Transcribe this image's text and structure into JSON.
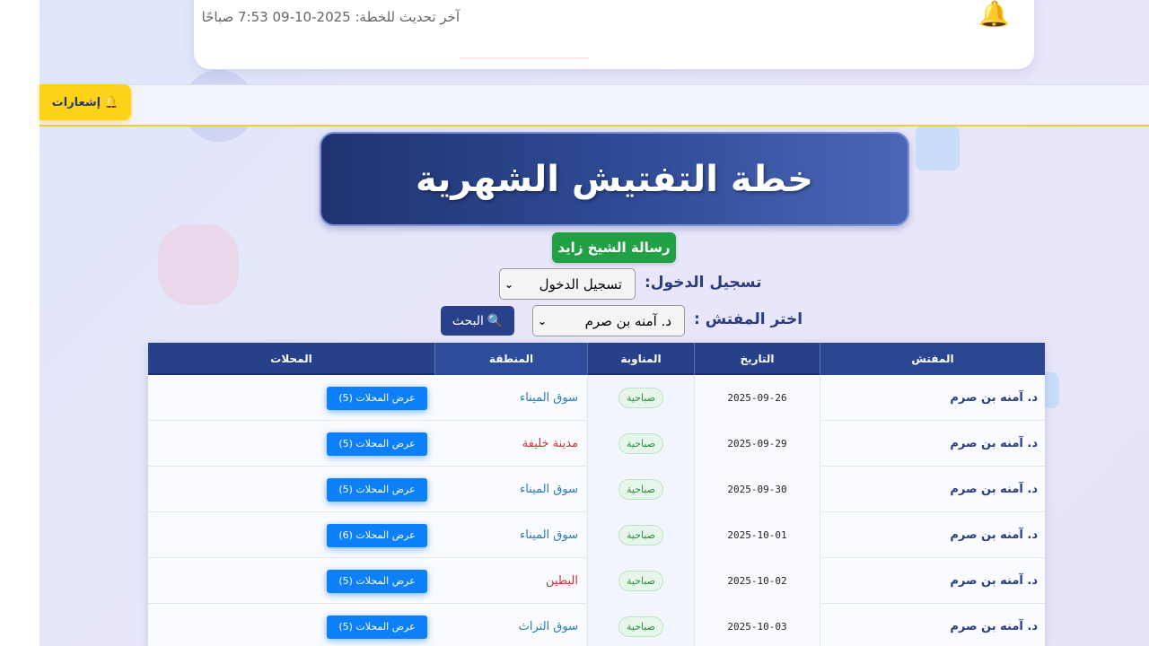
{
  "notice": {
    "text": "آخر تحديث للخطة: 2025-10-09 7:53 صباحًا",
    "icon": "bell-icon"
  },
  "notifications": {
    "icon": "🔔",
    "label": "إشعارات",
    "color": "#ffd21a"
  },
  "header": {
    "title": "خطة التفتيش الشهرية"
  },
  "actions": {
    "sheikh_zayed_label": "رسالة الشيخ زايد"
  },
  "login": {
    "label": "تسجيل الدخول:",
    "selected": "تسجيل الدخول"
  },
  "filter": {
    "label": "اختر المفتش :",
    "selected": "د. آمنه بن صرم",
    "search_icon": "🔍",
    "search_label": "البحث"
  },
  "table": {
    "columns": {
      "inspector": "المفتش",
      "date": "التاريخ",
      "shift": "المناوبة",
      "area": "المنطقة",
      "shops": "المحلات"
    },
    "rows": [
      {
        "inspector": "د. آمنه بن صرم",
        "date": "2025-09-26",
        "shift": "صباحية",
        "area": "سوق الميناء",
        "area_color": "#2a7ab8",
        "shops": "عرض المحلات (5)"
      },
      {
        "inspector": "د. آمنه بن صرم",
        "date": "2025-09-29",
        "shift": "صباحية",
        "area": "مدينة خليفة",
        "area_color": "#d12f2f",
        "shops": "عرض المحلات (5)"
      },
      {
        "inspector": "د. آمنه بن صرم",
        "date": "2025-09-30",
        "shift": "صباحية",
        "area": "سوق الميناء",
        "area_color": "#2a7ab8",
        "shops": "عرض المحلات (5)"
      },
      {
        "inspector": "د. آمنه بن صرم",
        "date": "2025-10-01",
        "shift": "صباحية",
        "area": "سوق الميناء",
        "area_color": "#2a7ab8",
        "shops": "عرض المحلات (6)"
      },
      {
        "inspector": "د. آمنه بن صرم",
        "date": "2025-10-02",
        "shift": "صباحية",
        "area": "البطين",
        "area_color": "#d12f2f",
        "shops": "عرض المحلات (5)"
      },
      {
        "inspector": "د. آمنه بن صرم",
        "date": "2025-10-03",
        "shift": "صباحية",
        "area": "سوق التراث",
        "area_color": "#2a7ab8",
        "shops": "عرض المحلات (5)"
      }
    ]
  }
}
